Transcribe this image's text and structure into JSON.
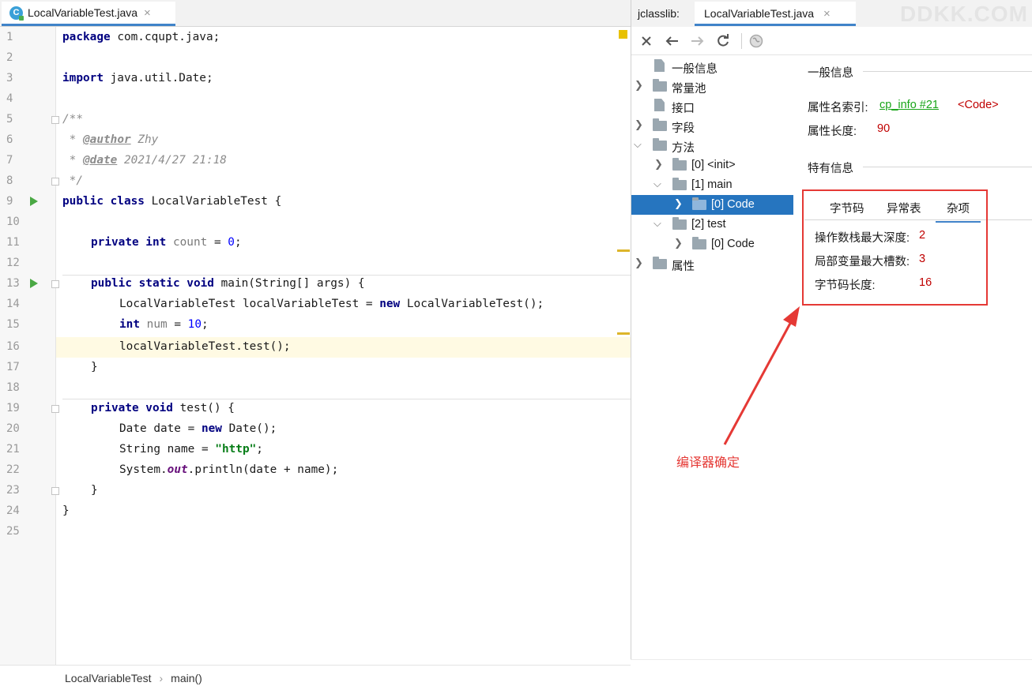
{
  "editor": {
    "tab_label": "LocalVariableTest.java",
    "file_icon_letter": "C",
    "close_glyph": "×",
    "line_numbers": [
      "1",
      "2",
      "3",
      "4",
      "5",
      "6",
      "7",
      "8",
      "9",
      "10",
      "11",
      "12",
      "13",
      "14",
      "15",
      "16",
      "17",
      "18",
      "19",
      "20",
      "21",
      "22",
      "23",
      "24",
      "25"
    ],
    "lines": {
      "l1_kw": "package",
      "l1_rest": " com.cqupt.java;",
      "l3_kw": "import",
      "l3_rest": " java.util.Date;",
      "l5": "/**",
      "l6_pre": " * ",
      "l6_tag": "@author",
      "l6_rest": " Zhy",
      "l7_pre": " * ",
      "l7_tag": "@date",
      "l7_rest": " 2021/4/27 21:18",
      "l8": " */",
      "l9_kw": "public class",
      "l9_rest": " LocalVariableTest {",
      "l11_kw": "private int",
      "l11_var": " count",
      "l11_eq": " = ",
      "l11_num": "0",
      "l11_end": ";",
      "l13_kw": "public static void",
      "l13_rest": " main(String[] args) {",
      "l14_a": "LocalVariableTest localVariableTest = ",
      "l14_kw": "new",
      "l14_b": " LocalVariableTest();",
      "l15_kw": "int",
      "l15_var": " num",
      "l15_eq": " = ",
      "l15_num": "10",
      "l15_end": ";",
      "l16": "localVariableTest.test();",
      "l17": "}",
      "l19_kw": "private void",
      "l19_rest": " test() {",
      "l20_a": "Date date = ",
      "l20_kw": "new",
      "l20_b": " Date();",
      "l21_a": "String name = ",
      "l21_str": "\"http\"",
      "l21_end": ";",
      "l22_a": "System.",
      "l22_fld": "out",
      "l22_b": ".println(date + name);",
      "l23": "}",
      "l24": "}"
    },
    "breadcrumb": [
      "LocalVariableTest",
      "main()"
    ],
    "breadcrumb_sep": "›"
  },
  "jclasslib": {
    "tab_prefix": "jclasslib:",
    "tab_label": "LocalVariableTest.java",
    "close_glyph": "×",
    "watermark": "DDKK.COM",
    "toolbar": {
      "close_icon": "close-icon",
      "back_icon": "arrow-left-icon",
      "forward_icon": "arrow-right-icon",
      "refresh_icon": "refresh-icon",
      "web_icon": "globe-icon"
    },
    "tree": [
      {
        "label": "一般信息"
      },
      {
        "label": "常量池"
      },
      {
        "label": "接口"
      },
      {
        "label": "字段"
      },
      {
        "label": "方法"
      },
      {
        "label": "[0] <init>"
      },
      {
        "label": "[1] main"
      },
      {
        "label": "[0] Code"
      },
      {
        "label": "[2] test"
      },
      {
        "label": "[0] Code"
      },
      {
        "label": "属性"
      }
    ],
    "general_title": "一般信息",
    "name_index_label": "属性名索引:",
    "name_index_link": "cp_info #21",
    "name_index_value": "<Code>",
    "length_label": "属性长度:",
    "length_value": "90",
    "specific_title": "特有信息",
    "subtabs": [
      "字节码",
      "异常表",
      "杂项"
    ],
    "misc": [
      {
        "label": "操作数栈最大深度:",
        "value": "2"
      },
      {
        "label": "局部变量最大槽数:",
        "value": "3"
      },
      {
        "label": "字节码长度:",
        "value": "16"
      }
    ]
  },
  "annotation": {
    "text": "编译器确定",
    "color": "#e53935"
  }
}
